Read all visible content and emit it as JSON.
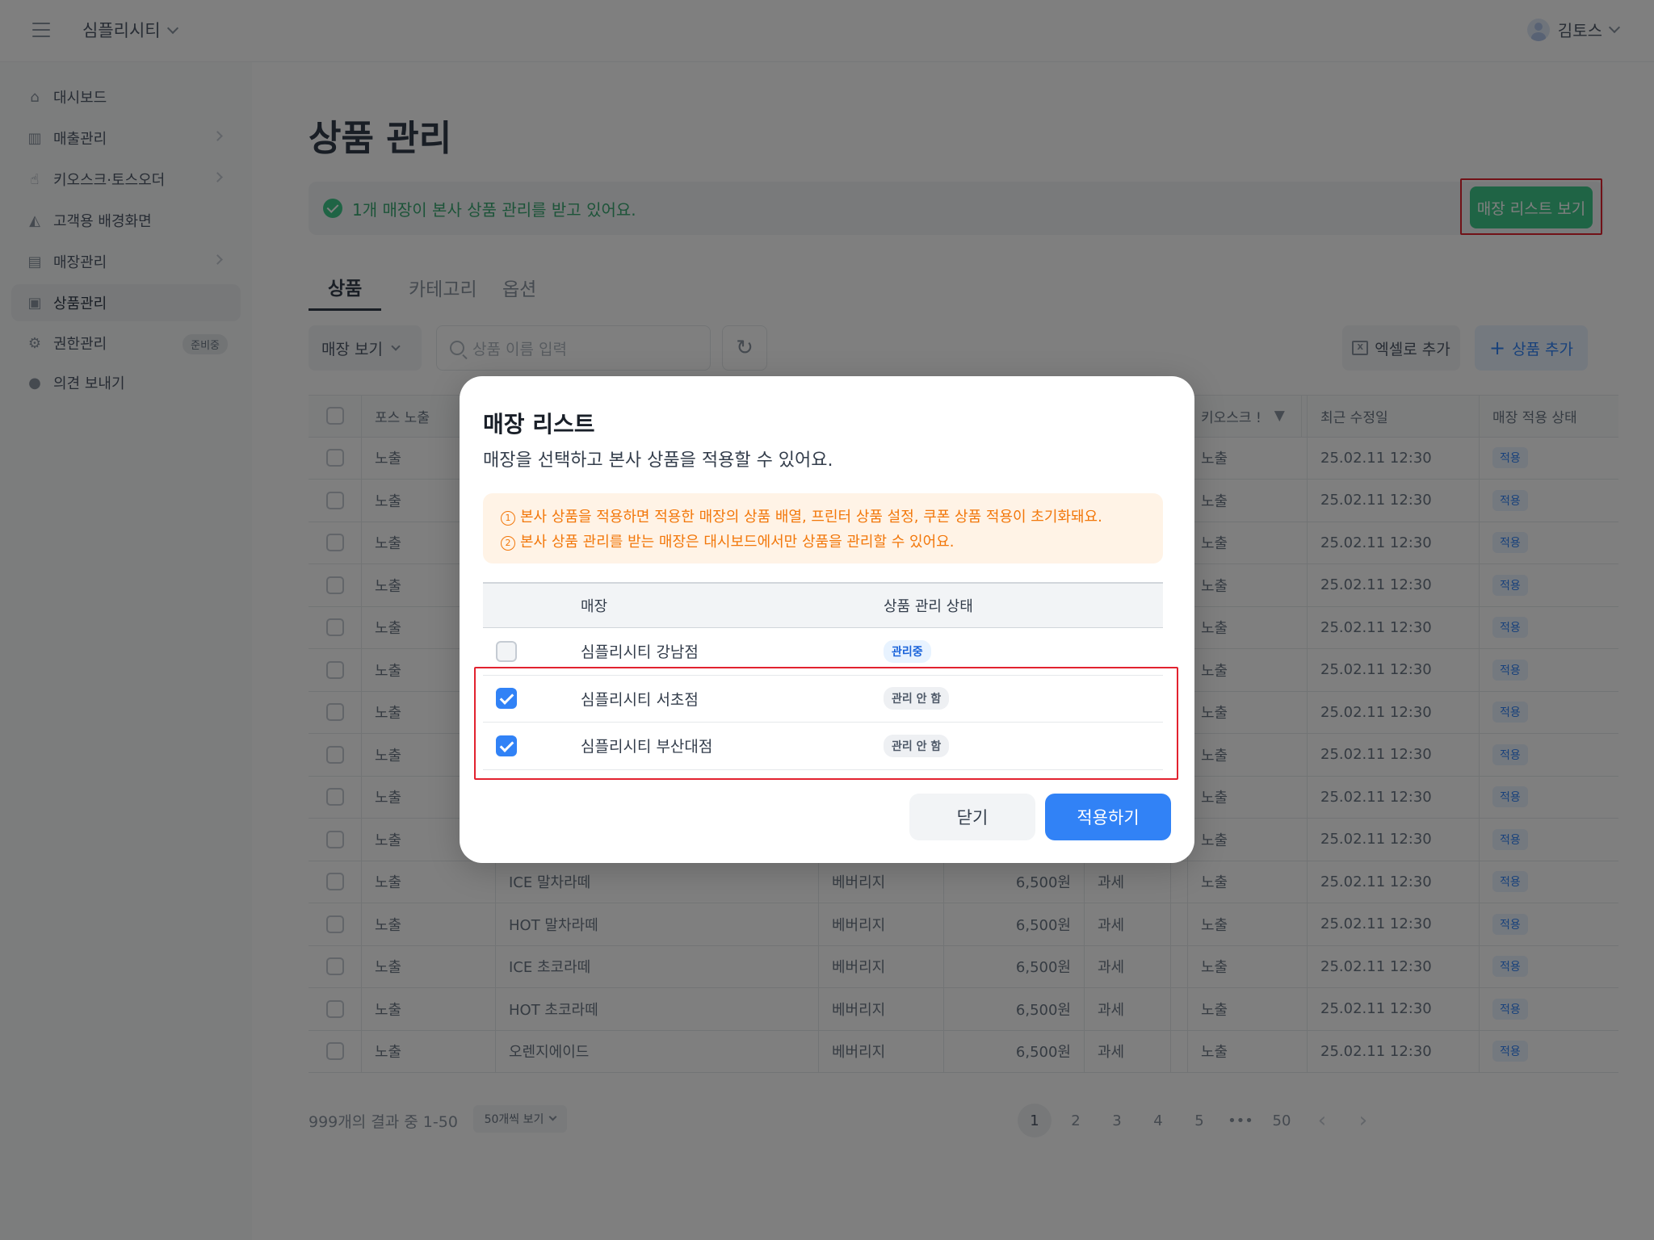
{
  "app": {
    "brand": "심플리시티",
    "user": "김토스"
  },
  "sidebar": {
    "items": [
      {
        "label": "대시보드",
        "icon": "home-icon"
      },
      {
        "label": "매출관리",
        "icon": "chart-icon"
      },
      {
        "label": "키오스크·토스오더",
        "icon": "hand-icon"
      },
      {
        "label": "고객용 배경화면",
        "icon": "image-icon"
      },
      {
        "label": "매장관리",
        "icon": "store-icon"
      },
      {
        "label": "상품관리",
        "icon": "tag-icon"
      },
      {
        "label": "권한관리",
        "icon": "gear-icon",
        "badge": "준비중"
      },
      {
        "label": "의견 보내기",
        "icon": "chat-icon"
      }
    ]
  },
  "page": {
    "title": "상품 관리",
    "notice": "1개 매장이 본사 상품 관리를 받고 있어요.",
    "store_list_button": "매장 리스트 보기",
    "tabs": [
      "상품",
      "카테고리",
      "옵션"
    ]
  },
  "toolbar": {
    "view_select": "매장 보기",
    "search_placeholder": "상품 이름 입력",
    "excel_button": "엑셀로 추가",
    "add_button": "상품 추가"
  },
  "table": {
    "headers": {
      "pos": "포스 노출",
      "kiosk": "키오스크 !",
      "updated": "최근 수정일",
      "apply": "매장 적용 상태"
    },
    "rows": [
      {
        "pos": "노출",
        "name": "",
        "cat": "",
        "price": "",
        "tax": "",
        "kiosk": "노출",
        "updated": "25.02.11 12:30",
        "apply": "적용"
      },
      {
        "pos": "노출",
        "name": "",
        "cat": "",
        "price": "",
        "tax": "",
        "kiosk": "노출",
        "updated": "25.02.11 12:30",
        "apply": "적용"
      },
      {
        "pos": "노출",
        "name": "",
        "cat": "",
        "price": "",
        "tax": "",
        "kiosk": "노출",
        "updated": "25.02.11 12:30",
        "apply": "적용"
      },
      {
        "pos": "노출",
        "name": "",
        "cat": "",
        "price": "",
        "tax": "",
        "kiosk": "노출",
        "updated": "25.02.11 12:30",
        "apply": "적용"
      },
      {
        "pos": "노출",
        "name": "",
        "cat": "",
        "price": "",
        "tax": "",
        "kiosk": "노출",
        "updated": "25.02.11 12:30",
        "apply": "적용"
      },
      {
        "pos": "노출",
        "name": "",
        "cat": "",
        "price": "",
        "tax": "",
        "kiosk": "노출",
        "updated": "25.02.11 12:30",
        "apply": "적용"
      },
      {
        "pos": "노출",
        "name": "",
        "cat": "",
        "price": "",
        "tax": "",
        "kiosk": "노출",
        "updated": "25.02.11 12:30",
        "apply": "적용"
      },
      {
        "pos": "노출",
        "name": "",
        "cat": "",
        "price": "",
        "tax": "",
        "kiosk": "노출",
        "updated": "25.02.11 12:30",
        "apply": "적용"
      },
      {
        "pos": "노출",
        "name": "",
        "cat": "",
        "price": "",
        "tax": "",
        "kiosk": "노출",
        "updated": "25.02.11 12:30",
        "apply": "적용"
      },
      {
        "pos": "노출",
        "name": "",
        "cat": "",
        "price": "",
        "tax": "",
        "kiosk": "노출",
        "updated": "25.02.11 12:30",
        "apply": "적용"
      },
      {
        "pos": "노출",
        "name": "ICE 말차라떼",
        "cat": "베버리지",
        "price": "6,500원",
        "tax": "과세",
        "kiosk": "노출",
        "updated": "25.02.11 12:30",
        "apply": "적용"
      },
      {
        "pos": "노출",
        "name": "HOT 말차라떼",
        "cat": "베버리지",
        "price": "6,500원",
        "tax": "과세",
        "kiosk": "노출",
        "updated": "25.02.11 12:30",
        "apply": "적용"
      },
      {
        "pos": "노출",
        "name": "ICE 초코라떼",
        "cat": "베버리지",
        "price": "6,500원",
        "tax": "과세",
        "kiosk": "노출",
        "updated": "25.02.11 12:30",
        "apply": "적용"
      },
      {
        "pos": "노출",
        "name": "HOT 초코라떼",
        "cat": "베버리지",
        "price": "6,500원",
        "tax": "과세",
        "kiosk": "노출",
        "updated": "25.02.11 12:30",
        "apply": "적용"
      },
      {
        "pos": "노출",
        "name": "오렌지에이드",
        "cat": "베버리지",
        "price": "6,500원",
        "tax": "과세",
        "kiosk": "노출",
        "updated": "25.02.11 12:30",
        "apply": "적용"
      }
    ]
  },
  "pagination": {
    "summary": "999개의 결과 중 1-50",
    "per_page": "50개씩 보기",
    "pages": [
      "1",
      "2",
      "3",
      "4",
      "5",
      "•••",
      "50"
    ],
    "current": "1"
  },
  "modal": {
    "title": "매장 리스트",
    "subtitle": "매장을 선택하고 본사 상품을 적용할 수 있어요.",
    "warnings": [
      {
        "num": "1",
        "text": "본사 상품을 적용하면 적용한 매장의 상품 배열, 프린터 상품 설정, 쿠폰 상품 적용이 초기화돼요."
      },
      {
        "num": "2",
        "text": "본사 상품 관리를 받는 매장은 대시보드에서만 상품을 관리할 수 있어요."
      }
    ],
    "headers": {
      "store": "매장",
      "status": "상품 관리 상태"
    },
    "stores": [
      {
        "name": "심플리시티 강남점",
        "status": "관리중",
        "checked": false
      },
      {
        "name": "심플리시티 서초점",
        "status": "관리 안 함",
        "checked": true
      },
      {
        "name": "심플리시티 부산대점",
        "status": "관리 안 함",
        "checked": true
      }
    ],
    "close_button": "닫기",
    "apply_button": "적용하기"
  },
  "colors": {
    "primary": "#3182f6",
    "success": "#3fc98a",
    "warning": "#f2770a",
    "highlight": "#e2222f"
  }
}
